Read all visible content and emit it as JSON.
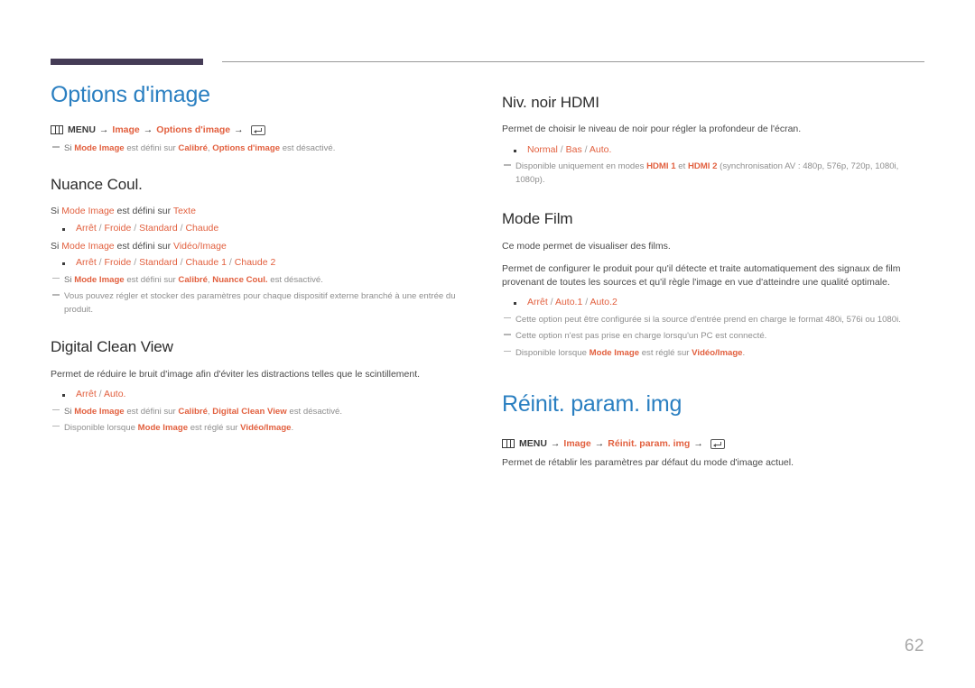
{
  "document": {
    "page_number": "62",
    "colors": {
      "chapter_title": "#2a7fc1",
      "section_title": "#2b2b2b",
      "highlight": "#e2603f",
      "note_text": "#8e8e8e",
      "body_text": "#4a4a4a",
      "header_bar": "#453c56"
    }
  },
  "left_column": {
    "chapter": {
      "title": "Options d'image",
      "menu_path": {
        "menu_icon": "menu-grid-icon",
        "menu_label": "MENU",
        "arrow": "→",
        "items": [
          "Image",
          "Options d'image"
        ],
        "enter_icon": "enter-key-icon"
      },
      "note": {
        "prefix": "Si ",
        "term1": "Mode Image",
        "mid1": " est défini sur ",
        "term2": "Calibré",
        "mid2": ", ",
        "term3": "Options d'image",
        "suffix": " est désactivé."
      }
    },
    "nuance_coul": {
      "title": "Nuance Coul.",
      "cond1": {
        "pre": "Si ",
        "hl1": "Mode Image",
        "mid": " est défini sur ",
        "hl2": "Texte"
      },
      "opts1": [
        {
          "label": "Arrêt"
        },
        {
          "label": "Froide"
        },
        {
          "label": "Standard"
        },
        {
          "label": "Chaude"
        }
      ],
      "cond2": {
        "pre": "Si ",
        "hl1": "Mode Image",
        "mid": " est défini sur ",
        "hl2": "Vidéo/Image"
      },
      "opts2": [
        {
          "label": "Arrêt"
        },
        {
          "label": "Froide"
        },
        {
          "label": "Standard"
        },
        {
          "label": "Chaude 1"
        },
        {
          "label": "Chaude 2"
        }
      ],
      "note1": {
        "prefix": "Si ",
        "term1": "Mode Image",
        "mid1": " est défini sur ",
        "term2": "Calibré",
        "mid2": ", ",
        "term3": "Nuance Coul.",
        "suffix": " est désactivé."
      },
      "note2": "Vous pouvez régler et stocker des paramètres pour chaque dispositif externe branché à une entrée du produit."
    },
    "digital_clean_view": {
      "title": "Digital Clean View",
      "body": "Permet de réduire le bruit d'image afin d'éviter les distractions telles que le scintillement.",
      "opts": [
        {
          "label": "Arrêt"
        },
        {
          "label": "Auto."
        }
      ],
      "note1": {
        "prefix": "Si ",
        "term1": "Mode Image",
        "mid1": " est défini sur ",
        "term2": "Calibré",
        "mid2": ", ",
        "term3": "Digital Clean View",
        "suffix": " est désactivé."
      },
      "note2": {
        "prefix": "Disponible lorsque ",
        "term1": "Mode Image",
        "mid1": " est réglé sur ",
        "term2": "Vidéo/Image",
        "suffix": "."
      }
    }
  },
  "right_column": {
    "niv_noir_hdmi": {
      "title": "Niv. noir HDMI",
      "body": "Permet de choisir le niveau de noir pour régler la profondeur de l'écran.",
      "opts": [
        {
          "label": "Normal"
        },
        {
          "label": "Bas"
        },
        {
          "label": "Auto."
        }
      ],
      "note": {
        "prefix": "Disponible uniquement en modes ",
        "term1": "HDMI 1",
        "mid1": " et ",
        "term2": "HDMI 2",
        "suffix": " (synchronisation AV : 480p, 576p, 720p, 1080i, 1080p)."
      }
    },
    "mode_film": {
      "title": "Mode Film",
      "body1": "Ce mode permet de visualiser des films.",
      "body2": "Permet de configurer le produit pour qu'il détecte et traite automatiquement des signaux de film provenant de toutes les sources et qu'il règle l'image en vue d'atteindre une qualité optimale.",
      "opts": [
        {
          "label": "Arrêt"
        },
        {
          "label": "Auto.1"
        },
        {
          "label": "Auto.2"
        }
      ],
      "note1": "Cette option peut être configurée si la source d'entrée prend en charge le format 480i, 576i ou 1080i.",
      "note2": "Cette option n'est pas prise en charge lorsqu'un PC est connecté.",
      "note3": {
        "prefix": "Disponible lorsque ",
        "term1": "Mode Image",
        "mid1": " est réglé sur ",
        "term2": "Vidéo/Image",
        "suffix": "."
      }
    },
    "reinit_param_img": {
      "title": "Réinit. param. img",
      "menu_path": {
        "menu_icon": "menu-grid-icon",
        "menu_label": "MENU",
        "arrow": "→",
        "items": [
          "Image",
          "Réinit. param. img"
        ],
        "enter_icon": "enter-key-icon"
      },
      "body": "Permet de rétablir les paramètres par défaut du mode d'image actuel."
    }
  }
}
